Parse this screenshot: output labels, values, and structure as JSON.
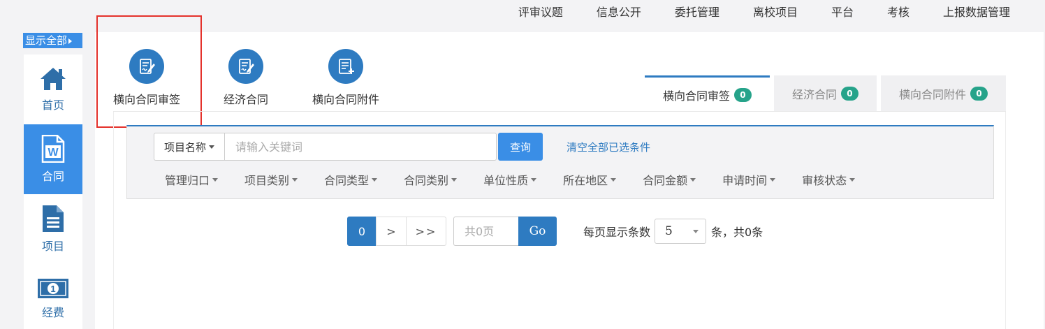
{
  "topnav": [
    "评审议题",
    "信息公开",
    "委托管理",
    "离校项目",
    "平台",
    "考核",
    "上报数据管理"
  ],
  "sidebar": {
    "show_all": "显示全部",
    "items": [
      {
        "label": "首页",
        "icon": "home-icon"
      },
      {
        "label": "合同",
        "icon": "word-doc-icon"
      },
      {
        "label": "项目",
        "icon": "document-icon"
      },
      {
        "label": "经费",
        "icon": "money-icon"
      }
    ],
    "active_index": 1
  },
  "icon_buttons": [
    {
      "label": "横向合同审签",
      "icon": "sign-doc-icon"
    },
    {
      "label": "经济合同",
      "icon": "sign-doc-icon"
    },
    {
      "label": "横向合同附件",
      "icon": "attachment-doc-icon"
    }
  ],
  "tabs": [
    {
      "label": "横向合同审签",
      "count": "0"
    },
    {
      "label": "经济合同",
      "count": "0"
    },
    {
      "label": "横向合同附件",
      "count": "0"
    }
  ],
  "search": {
    "field_label": "项目名称",
    "placeholder": "请输入关键词",
    "value": "",
    "query_label": "查询",
    "clear_label": "清空全部已选条件"
  },
  "filters": [
    "管理归口",
    "项目类别",
    "合同类型",
    "合同类别",
    "单位性质",
    "所在地区",
    "合同金额",
    "申请时间",
    "审核状态"
  ],
  "pager": {
    "current": "0",
    "next": ">",
    "last": ">>",
    "page_placeholder": "共0页",
    "go_label": "Go",
    "per_page_label": "每页显示条数",
    "per_page_value": "5",
    "total_text": "条，共0条"
  },
  "colors": {
    "accent": "#2e7bc1",
    "active_sidebar": "#3a8ee6",
    "badge": "#26a38a",
    "highlight": "#e4312b"
  }
}
